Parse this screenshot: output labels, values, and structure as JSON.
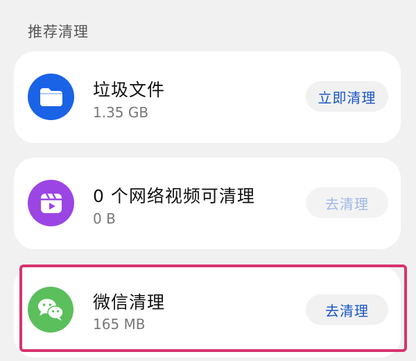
{
  "section": {
    "title": "推荐清理"
  },
  "items": [
    {
      "title": "垃圾文件",
      "size": "1.35 GB",
      "button": "立即清理",
      "icon": "folder-icon",
      "icon_color": "#1a62e6",
      "button_enabled": true
    },
    {
      "title": "0 个网络视频可清理",
      "size": "0 B",
      "button": "去清理",
      "icon": "video-clapper-icon",
      "icon_color": "#9b45e4",
      "button_enabled": false
    },
    {
      "title": "微信清理",
      "size": "165 MB",
      "button": "去清理",
      "icon": "wechat-icon",
      "icon_color": "#5bbf5c",
      "button_enabled": true
    }
  ],
  "colors": {
    "accent": "#1a56c4",
    "highlight": "#d8326e",
    "background": "#f1f1f1"
  }
}
